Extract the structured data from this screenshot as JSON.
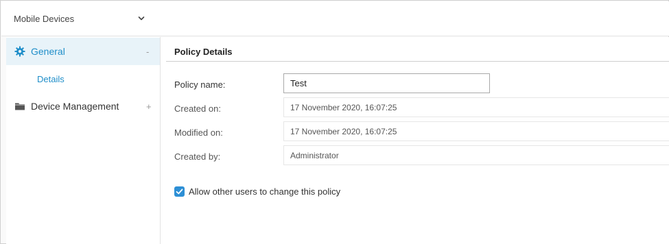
{
  "topbar": {
    "selector_label": "Mobile Devices",
    "selector_icon": "chevron-down-icon"
  },
  "sidebar": {
    "items": [
      {
        "label": "General",
        "icon": "gear-icon",
        "toggle": "-",
        "active": true
      },
      {
        "label": "Details",
        "sub": true,
        "selected": true
      },
      {
        "label": "Device Management",
        "icon": "folder-icon",
        "toggle": "+"
      }
    ]
  },
  "content": {
    "section_title": "Policy Details",
    "fields": {
      "policy_name": {
        "label": "Policy name:",
        "value": "Test"
      },
      "created_on": {
        "label": "Created on:",
        "value": "17 November 2020, 16:07:25"
      },
      "modified_on": {
        "label": "Modified on:",
        "value": "17 November 2020, 16:07:25"
      },
      "created_by": {
        "label": "Created by:",
        "value": "Administrator"
      }
    },
    "allow_change": {
      "label": "Allow other users to change this policy",
      "checked": true
    }
  },
  "colors": {
    "accent": "#1f8ec9",
    "active_bg": "#e8f3f9",
    "checkbox": "#2d8fd5"
  }
}
